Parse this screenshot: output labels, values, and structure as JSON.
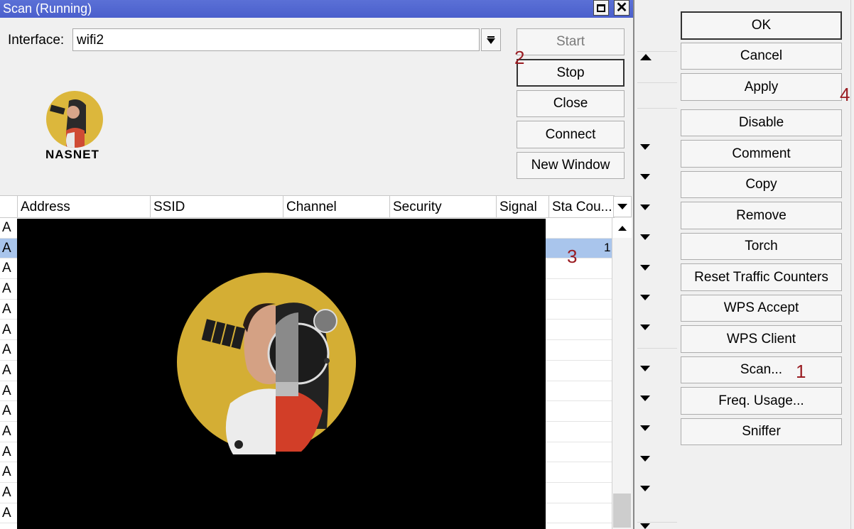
{
  "window": {
    "title": "Scan (Running)",
    "interface_label": "Interface:",
    "interface_value": "wifi2",
    "logo_text": "NASNET"
  },
  "scan_buttons": {
    "start": "Start",
    "stop": "Stop",
    "close": "Close",
    "connect": "Connect",
    "new_window": "New Window"
  },
  "table": {
    "columns": [
      "Address",
      "SSID",
      "Channel",
      "Security",
      "Signal",
      "Sta Cou..."
    ],
    "row_flag": "A",
    "selected_row_sta_count": "1"
  },
  "side_buttons": {
    "ok": "OK",
    "cancel": "Cancel",
    "apply": "Apply",
    "disable": "Disable",
    "comment": "Comment",
    "copy": "Copy",
    "remove": "Remove",
    "torch": "Torch",
    "reset_traffic": "Reset Traffic Counters",
    "wps_accept": "WPS Accept",
    "wps_client": "WPS Client",
    "scan": "Scan...",
    "freq_usage": "Freq. Usage...",
    "sniffer": "Sniffer"
  },
  "annotations": {
    "step1": "1",
    "step2": "2",
    "step3": "3",
    "step4": "4"
  },
  "colors": {
    "title_bar": "#4a5fcc",
    "selected_row": "#a9c5ec",
    "annotation": "#9a1c22",
    "logo_background": "#dcb73c"
  }
}
